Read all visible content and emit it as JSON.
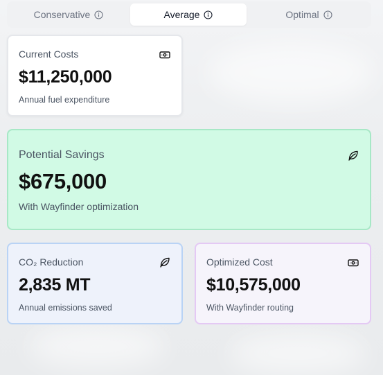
{
  "tabs": [
    {
      "label": "Conservative",
      "active": false,
      "icon": "info-icon"
    },
    {
      "label": "Average",
      "active": true,
      "icon": "info-icon"
    },
    {
      "label": "Optimal",
      "active": false,
      "icon": "info-icon"
    }
  ],
  "cards": {
    "current_costs": {
      "title": "Current Costs",
      "value": "$11,250,000",
      "subtitle": "Annual fuel expenditure",
      "icon": "banknote-icon"
    },
    "potential_savings": {
      "title": "Potential Savings",
      "value": "$675,000",
      "subtitle": "With Wayfinder optimization",
      "icon": "leaf-icon"
    },
    "co2_reduction": {
      "title": "CO₂ Reduction",
      "value": "2,835 MT",
      "subtitle": "Annual emissions saved",
      "icon": "leaf-icon"
    },
    "optimized_cost": {
      "title": "Optimized Cost",
      "value": "$10,575,000",
      "subtitle": "With Wayfinder routing",
      "icon": "banknote-icon"
    }
  },
  "colors": {
    "savings_bg": "#d1fae5",
    "savings_border": "#a7e8c6",
    "co2_bg": "#eef2fb",
    "co2_border": "#b9d3f5",
    "optimized_bg": "#f6f4fb",
    "optimized_border": "#e4c9f4"
  }
}
